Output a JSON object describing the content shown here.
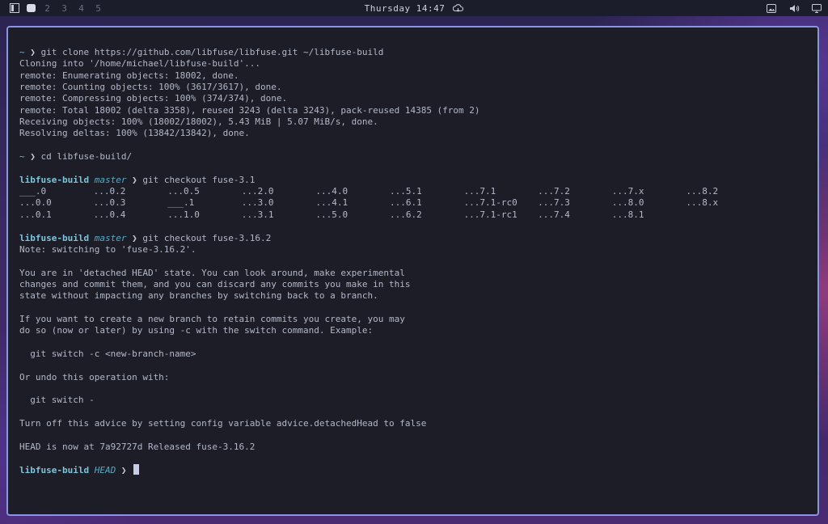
{
  "topbar": {
    "workspaces": [
      "2",
      "3",
      "4",
      "5"
    ],
    "clock": "Thursday 14:47"
  },
  "terminal": {
    "prompt_home": "~",
    "prompt_arrow": "❯",
    "dir": "libfuse-build",
    "cmd1": "git clone https://github.com/libfuse/libfuse.git ~/libfuse-build",
    "clone_output": [
      "Cloning into '/home/michael/libfuse-build'...",
      "remote: Enumerating objects: 18002, done.",
      "remote: Counting objects: 100% (3617/3617), done.",
      "remote: Compressing objects: 100% (374/374), done.",
      "remote: Total 18002 (delta 3358), reused 3243 (delta 3243), pack-reused 14385 (from 2)",
      "Receiving objects: 100% (18002/18002), 5.43 MiB | 5.07 MiB/s, done.",
      "Resolving deltas: 100% (13842/13842), done."
    ],
    "cmd2": "cd libfuse-build/",
    "branch1": "master",
    "cmd3": "git checkout fuse-3.1",
    "completions": [
      [
        "___.0",
        "...0.2",
        "...0.5",
        "...2.0",
        "...4.0",
        "...5.1",
        "...7.1",
        "...7.2",
        "...7.x",
        "...8.2"
      ],
      [
        "...0.0",
        "...0.3",
        "___.1",
        "...3.0",
        "...4.1",
        "...6.1",
        "...7.1-rc0",
        "...7.3",
        "...8.0",
        "...8.x"
      ],
      [
        "...0.1",
        "...0.4",
        "...1.0",
        "...3.1",
        "...5.0",
        "...6.2",
        "...7.1-rc1",
        "...7.4",
        "...8.1",
        ""
      ]
    ],
    "branch2": "master",
    "cmd4": "git checkout fuse-3.16.2",
    "checkout_output": [
      "Note: switching to 'fuse-3.16.2'.",
      "",
      "You are in 'detached HEAD' state. You can look around, make experimental",
      "changes and commit them, and you can discard any commits you make in this",
      "state without impacting any branches by switching back to a branch.",
      "",
      "If you want to create a new branch to retain commits you create, you may",
      "do so (now or later) by using -c with the switch command. Example:",
      "",
      "  git switch -c <new-branch-name>",
      "",
      "Or undo this operation with:",
      "",
      "  git switch -",
      "",
      "Turn off this advice by setting config variable advice.detachedHead to false",
      "",
      "HEAD is now at 7a92727d Released fuse-3.16.2"
    ],
    "branch3": "HEAD"
  },
  "icons": {
    "layout": "layout-icon",
    "workspace_active": "workspace-dot-icon",
    "cloud": "cloud-icon",
    "screenshot": "screenshot-icon",
    "volume": "volume-icon",
    "display": "display-icon"
  },
  "colors": {
    "border": "#8a93e6",
    "terminal_bg": "#1c1d27",
    "dir": "#7fc4d8"
  }
}
